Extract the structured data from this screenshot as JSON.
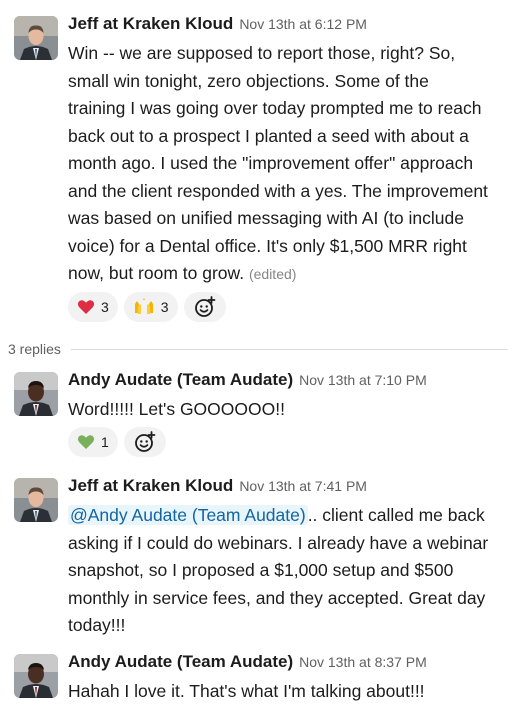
{
  "messages": [
    {
      "author": "Jeff at Kraken Kloud",
      "timestamp": "Nov 13th at 6:12 PM",
      "avatar_icon": "avatar-jeff",
      "lines": [
        "Win -- we are supposed to report those, right? So,",
        "small win tonight, zero objections. Some of the",
        "training I was going over today prompted me to reach",
        "back out to a prospect I planted a seed with about a",
        "month ago. I used the \"improvement offer\" approach",
        "and the client responded with a yes. The improvement",
        "was based on unified messaging with AI (to include",
        "voice) for a Dental office. It's only $1,500 MRR right",
        "now, but room to grow."
      ],
      "edited_label": "(edited)",
      "reactions": [
        {
          "emoji": "heart-emoji",
          "count": "3"
        },
        {
          "emoji": "raised-hands-emoji",
          "count": "3"
        }
      ]
    },
    {
      "author": "Andy Audate (Team Audate)",
      "timestamp": "Nov 13th at 7:10 PM",
      "avatar_icon": "avatar-andy",
      "lines": [
        "Word!!!!! Let's GOOOOOO!!"
      ],
      "reactions": [
        {
          "emoji": "green-heart-emoji",
          "count": "1"
        }
      ]
    },
    {
      "author": "Jeff at Kraken Kloud",
      "timestamp": "Nov 13th at 7:41 PM",
      "avatar_icon": "avatar-jeff",
      "mention": "@Andy Audate (Team Audate)",
      "lines": [
        ".. client called me back",
        "asking if I could do webinars.  I already have a webinar",
        "snapshot, so I proposed a $1,000 setup and $500",
        "monthly in service fees, and they accepted.  Great day",
        "today!!!"
      ]
    },
    {
      "author": "Andy Audate (Team Audate)",
      "timestamp": "Nov 13th at 8:37 PM",
      "avatar_icon": "avatar-andy",
      "lines": [
        "Hahah I love it. That's what I'm talking about!!!"
      ]
    }
  ],
  "thread": {
    "replies_label": "3 replies"
  },
  "add_reaction_icon": "add-reaction-icon",
  "colors": {
    "mention_bg": "#e8f5fa",
    "mention_text": "#1264a3",
    "reaction_bg": "#f2f2f2"
  }
}
